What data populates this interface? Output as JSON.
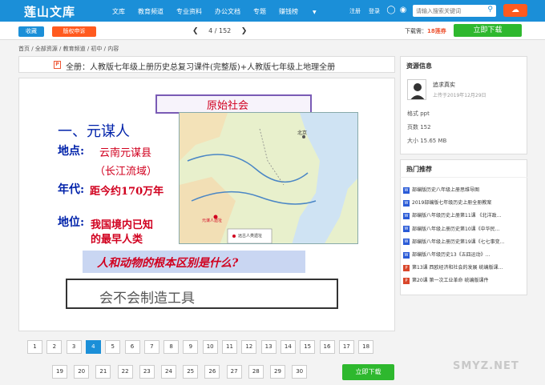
{
  "header": {
    "logo": "莲山文库",
    "nav": [
      "文库",
      "教育频道",
      "专业资料",
      "办公文档",
      "专题"
    ],
    "nav_tag": "赚钱榜",
    "login": "注册",
    "register": "登录",
    "search_placeholder": "请输入搜索关键词",
    "icons": [
      "qq-icon",
      "wechat-icon",
      "weibo-icon",
      "search-icon",
      "upload-cloud-icon"
    ],
    "brand_color": "#1b8fd8"
  },
  "toolbar": {
    "collect": "收藏",
    "report": "版权申诉",
    "page_current": "4",
    "page_total": "/ 152",
    "download_label": "下载需：",
    "download_cost": "18莲券",
    "download_button": "立即下载"
  },
  "breadcrumb": "首页 / 全部资源 / 教育频道 / 初中 / 内容",
  "doc": {
    "type_badge": "P",
    "title": "全册：人教版七年级上册历史总复习课件(完整版)+人教版七年级上地理全册"
  },
  "slide": {
    "banner": "原始社会",
    "heading": "一、元谋人",
    "place_label": "地点:",
    "place_value": "云南元谋县",
    "place_sub": "（长江流域）",
    "era_label": "年代:",
    "era_value": "距今约170万年",
    "status_label": "地位:",
    "status_value1": "我国境内已知",
    "status_value2": "的最早人类",
    "map_city": "北京",
    "map_marker": "元谋人遗址",
    "map_legend": "远古人类遗址",
    "question": "人和动物的根本区别是什么?",
    "answer": "会不会制造工具"
  },
  "pagination": {
    "row1": [
      "1",
      "2",
      "3",
      "4",
      "5",
      "6",
      "7",
      "8",
      "9",
      "10",
      "11",
      "12",
      "13",
      "14",
      "15",
      "16",
      "17",
      "18"
    ],
    "row2": [
      "19",
      "20",
      "21",
      "22",
      "23",
      "24",
      "25",
      "26",
      "27",
      "28",
      "29",
      "30"
    ],
    "active": "4",
    "download_button": "立即下载"
  },
  "sidebar": {
    "info_title": "资源信息",
    "author": "追求真实",
    "upload_date": "上传于2019年12月29日",
    "format": "格式 ppt",
    "pages": "页数 152",
    "size": "大小 15.65 MB",
    "hot_title": "热门推荐",
    "hot_items": [
      {
        "type": "w",
        "text": "部编版历史八年级上册思维导图"
      },
      {
        "type": "w",
        "text": "2019部编版七年级历史上册全册教案"
      },
      {
        "type": "w",
        "text": "部编版八年级历史上册第11课 《北洋政…"
      },
      {
        "type": "w",
        "text": "部编版八年级上册历史第10课《中华民…"
      },
      {
        "type": "w",
        "text": "部编版八年级上册历史第19课《七七事变…"
      },
      {
        "type": "w",
        "text": "部编版八年级历史13《五四运动》…"
      },
      {
        "type": "p",
        "text": "第13课 西欧经济和社会的发展 统编版课…"
      },
      {
        "type": "p",
        "text": "第20课 第一次工业革命 统编版课件"
      }
    ]
  },
  "watermark": "SMYZ.NET"
}
